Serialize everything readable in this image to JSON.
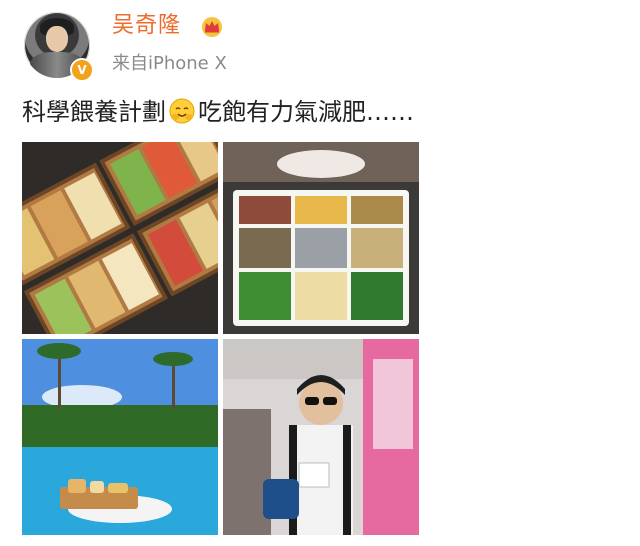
{
  "post": {
    "username": "吴奇隆",
    "source": "来自iPhone X",
    "verified_mark": "V",
    "text_part1": "科學餵養計劃",
    "text_part2": "吃飽有力氣減肥……",
    "emoji_icon": "hug-face-emoji",
    "username_icon": "crown-icon",
    "accent_color": "#ef6b2c",
    "verified_color": "#f2a21b"
  },
  "photos": [
    {
      "subject": "bento-trays-photo"
    },
    {
      "subject": "meal-box-photo"
    },
    {
      "subject": "pool-breakfast-photo"
    },
    {
      "subject": "man-with-sunglasses-photo"
    }
  ]
}
